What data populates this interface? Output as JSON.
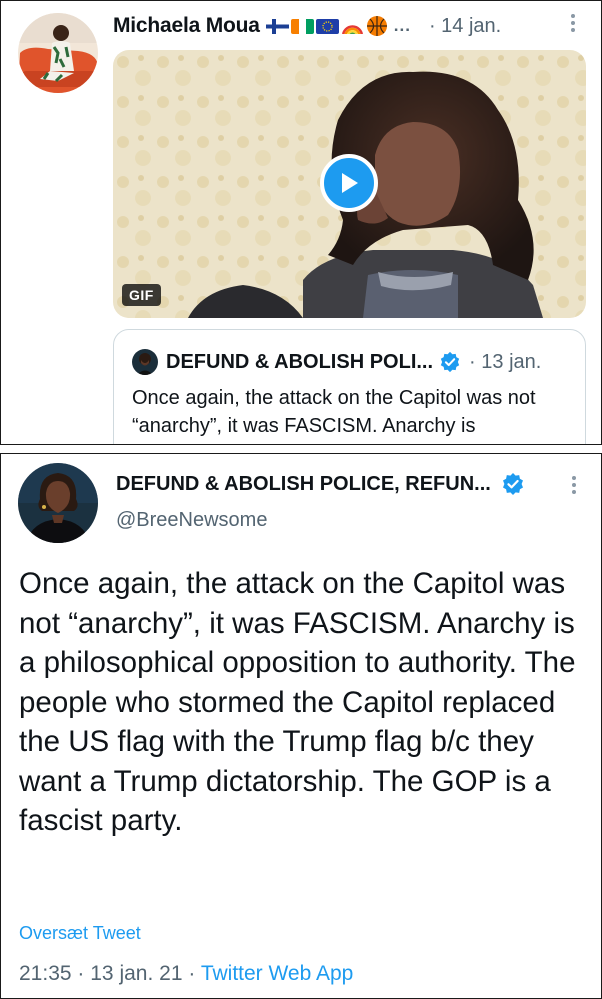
{
  "tweet1": {
    "author_name": "Michaela Moua",
    "name_emojis": [
      "flag-finland-icon",
      "flag-ivory-coast-icon",
      "flag-eu-icon",
      "rainbow-icon",
      "basketball-icon"
    ],
    "truncation": "...",
    "date": "· 14 jan.",
    "media": {
      "badge": "GIF"
    },
    "quote": {
      "author_name": "DEFUND & ABOLISH POLI...",
      "date": "· 13 jan.",
      "text": "Once again, the attack on the Capitol was not “anarchy”, it was FASCISM. Anarchy is"
    }
  },
  "tweet2": {
    "author_name": "DEFUND & ABOLISH POLICE, REFUN...",
    "handle": "@BreeNewsome",
    "text": "Once again, the attack on the Capitol was not “anarchy”, it was FASCISM. Anarchy is a philosophical opposition to authority. The people who stormed the Capitol replaced the US flag with the Trump flag b/c they want a Trump dictatorship. The GOP is a fascist party.",
    "translate_label": "Oversæt Tweet",
    "time": "21:35",
    "date": "13 jan. 21",
    "source": "Twitter Web App",
    "separator": "·"
  },
  "colors": {
    "accent": "#1d9bf0",
    "secondary_text": "#536471",
    "border": "#cfd9de"
  }
}
